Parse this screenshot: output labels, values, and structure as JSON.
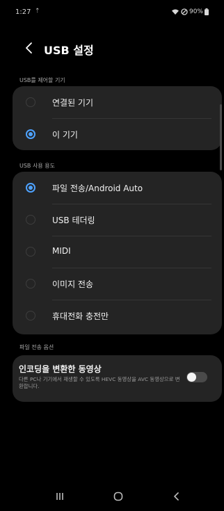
{
  "status_bar": {
    "time": "1:27",
    "notification_glyph": "⇡",
    "battery": "90%",
    "icons": [
      "wifi-icon",
      "dnd-icon",
      "battery-icon"
    ]
  },
  "header": {
    "back_icon": "chevron-left-icon",
    "title": "USB 설정"
  },
  "usb_control": {
    "section_label": "USB를 제어할 기기",
    "options": [
      {
        "label": "연결된 기기",
        "selected": false
      },
      {
        "label": "이 기기",
        "selected": true
      }
    ]
  },
  "usb_usage": {
    "section_label": "USB 사용 용도",
    "options": [
      {
        "label": "파일 전송/Android Auto",
        "selected": true
      },
      {
        "label": "USB 테더링",
        "selected": false
      },
      {
        "label": "MIDI",
        "selected": false
      },
      {
        "label": "이미지 전송",
        "selected": false
      },
      {
        "label": "휴대전화 충전만",
        "selected": false
      }
    ]
  },
  "file_transfer_options": {
    "section_label": "파일 전송 옵션",
    "setting": {
      "title": "인코딩을 변환한 동영상",
      "description": "다른 PC나 기기에서 재생할 수 있도록 HEVC 동영상을 AVC 동영상으로 변환합니다.",
      "enabled": false
    }
  },
  "nav_bar": {
    "icons": [
      "recents-icon",
      "home-icon",
      "back-icon"
    ]
  },
  "colors": {
    "accent": "#4ea2ff",
    "card": "#242424",
    "background": "#000000"
  }
}
